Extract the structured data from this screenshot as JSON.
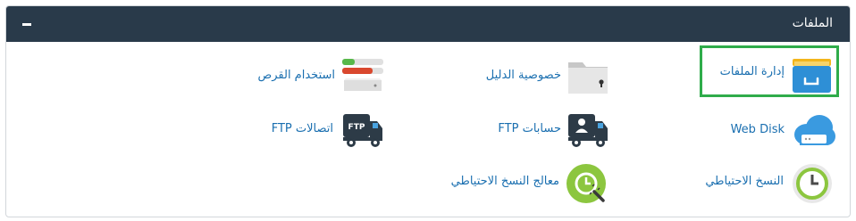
{
  "panel": {
    "title": "الملفات",
    "collapse_icon": "minus-icon"
  },
  "items": [
    {
      "label": "إدارة الملفات",
      "icon": "file-manager-icon",
      "highlighted": true
    },
    {
      "label": "خصوصية الدليل",
      "icon": "folder-lock-icon"
    },
    {
      "label": "استخدام القرص",
      "icon": "disk-usage-icon"
    },
    {
      "label": "Web Disk",
      "icon": "web-disk-icon"
    },
    {
      "label": "حسابات FTP",
      "icon": "ftp-accounts-icon"
    },
    {
      "label": "اتصالات FTP",
      "icon": "ftp-connections-icon"
    },
    {
      "label": "النسخ الاحتياطي",
      "icon": "backup-icon"
    },
    {
      "label": "معالج النسخ الاحتياطي",
      "icon": "backup-wizard-icon"
    }
  ],
  "colors": {
    "header": "#293a4a",
    "link": "#1a6fb0",
    "highlight": "#2fac4a"
  }
}
